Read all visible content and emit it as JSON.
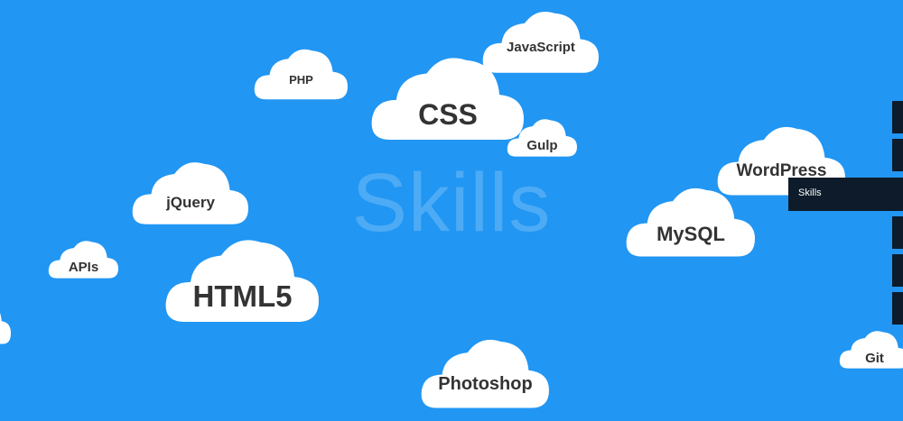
{
  "section": {
    "title": "Skills"
  },
  "clouds": [
    {
      "id": "javascript",
      "label": "JavaScript"
    },
    {
      "id": "php",
      "label": "PHP"
    },
    {
      "id": "css",
      "label": "CSS"
    },
    {
      "id": "gulp",
      "label": "Gulp"
    },
    {
      "id": "wordpress",
      "label": "WordPress"
    },
    {
      "id": "jquery",
      "label": "jQuery"
    },
    {
      "id": "mysql",
      "label": "MySQL"
    },
    {
      "id": "apis",
      "label": "APIs"
    },
    {
      "id": "html5",
      "label": "HTML5"
    },
    {
      "id": "photoshop",
      "label": "Photoshop"
    },
    {
      "id": "git",
      "label": "Git"
    }
  ],
  "side_nav": {
    "active_label": "Skills"
  },
  "colors": {
    "background": "#2196f3",
    "cloud": "#ffffff",
    "nav": "#0d1b2a"
  }
}
